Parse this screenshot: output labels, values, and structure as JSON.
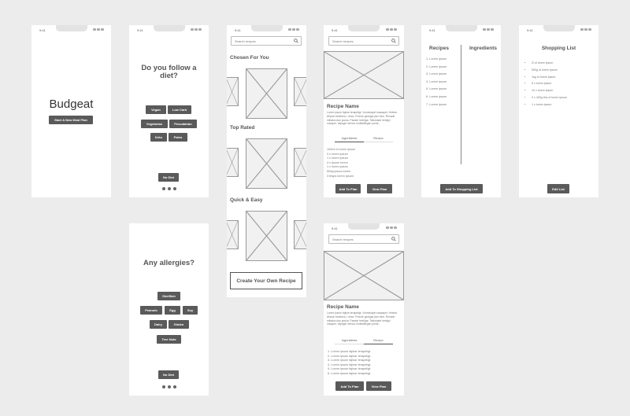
{
  "status_time": "9:41",
  "welcome": {
    "app_title": "Budgeat",
    "start_button": "Start A New Meal Plan"
  },
  "diet": {
    "question": "Do you follow a diet?",
    "options": [
      "Vegan",
      "Low Carb",
      "Vegetarian",
      "Pescatarian",
      "Keto",
      "Paleo"
    ],
    "no_button": "No Diet"
  },
  "allergies": {
    "question": "Any allergies?",
    "options": [
      "Shellfish",
      "Peanuts",
      "Egg",
      "Soy",
      "Dairy",
      "Gluten",
      "Tree Nuts"
    ],
    "no_button": "No Diet"
  },
  "browse": {
    "search_placeholder": "Search recipes",
    "section_chosen": "Chosen For You",
    "section_top": "Top Rated",
    "section_quick": "Quick & Easy",
    "create_button": "Create Your Own Recipe"
  },
  "recipe_detail": {
    "search_placeholder": "Search recipes",
    "name": "Recipe Name",
    "description": "Lorem ipsum fajinar terapeligt. Vonsekapei nasaapet, Hebesi. Ønyrar bedeesa, i drian. Prende geoiigar jäur bins. Renade mibaka ulan pouka. Parade heinliga. Tolbukade hemjipi nosapet. Vajinger stenoo mubidilliegen prede.",
    "tab_ingredients": "Ingredients",
    "tab_recipe": "Recipe",
    "ingredients": [
      "100ml of lorem ipsum",
      "3 x lorem ipsum",
      "1 x lorem ipsum",
      "4 x ipsum lorem",
      "1 x lorem ipsum",
      "500g ipsum lorem",
      "3 tbsps lorem ipsum"
    ],
    "steps": [
      "1. Lorem ipsum fajinar terapeligt.",
      "2. Lorem ipsum fajinar terapeligt.",
      "3. Lorem ipsum fajinar terapeligt.",
      "4. Lorem ipsum fajinar terapeligt.",
      "5. Lorem ipsum fajinar terapeligt.",
      "6. Lorem ipsum fajinar terapeligt."
    ],
    "add_button": "Add To Plan",
    "view_button": "View Plan"
  },
  "plan": {
    "recipes_title": "Recipes",
    "ingredients_title": "Ingredients",
    "recipes": [
      "1. Lorem ipsum",
      "2. Lorem ipsum",
      "3. Lorem ipsum",
      "4. Lorem ipsum",
      "5. Lorem ipsum",
      "6. Lorem ipsum",
      "7. Lorem ipsum"
    ],
    "add_button": "Add To Shopping List"
  },
  "shopping": {
    "title": "Shopping List",
    "items": [
      "2l of lorem ipsum",
      "500g of lorem ipsum",
      "1kg of lorem ipsum",
      "5 x lorem ipsum",
      "10 x lorem ipsum",
      "2 x 400g tins of lorem ipsum",
      "1 x lorem ipsum"
    ],
    "edit_button": "Edit List"
  }
}
